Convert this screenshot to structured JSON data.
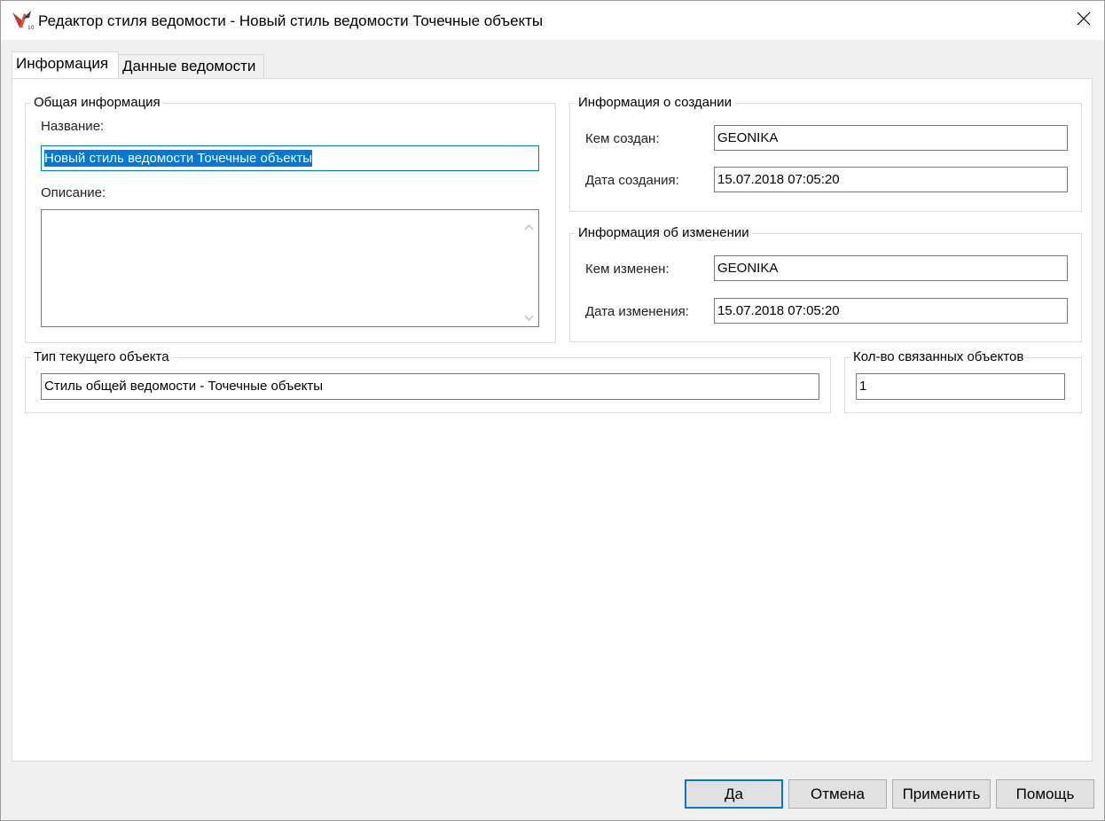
{
  "window": {
    "title": "Редактор стиля ведомости - Новый стиль ведомости Точечные объекты",
    "icon": "app-logo-icon",
    "close_icon": "close-icon"
  },
  "tabs": [
    {
      "label": "Информация",
      "active": true
    },
    {
      "label": "Данные ведомости",
      "active": false
    }
  ],
  "general_info": {
    "legend": "Общая информация",
    "name_label": "Название:",
    "name_value": "Новый стиль ведомости Точечные объекты",
    "description_label": "Описание:",
    "description_value": ""
  },
  "creation_info": {
    "legend": "Информация о создании",
    "created_by_label": "Кем создан:",
    "created_by_value": "GEONIKA",
    "created_date_label": "Дата создания:",
    "created_date_value": "15.07.2018 07:05:20"
  },
  "modification_info": {
    "legend": "Информация об изменении",
    "modified_by_label": "Кем изменен:",
    "modified_by_value": "GEONIKA",
    "modified_date_label": "Дата изменения:",
    "modified_date_value": "15.07.2018 07:05:20"
  },
  "object_type": {
    "legend": "Тип текущего объекта",
    "value": "Стиль общей ведомости - Точечные объекты"
  },
  "linked_count": {
    "legend": "Кол-во связанных объектов",
    "value": "1"
  },
  "buttons": {
    "ok": "Да",
    "cancel": "Отмена",
    "apply": "Применить",
    "help": "Помощь"
  },
  "colors": {
    "accent": "#0078d7",
    "button_bg": "#e1e1e1",
    "dialog_bg": "#f0f0f0"
  }
}
